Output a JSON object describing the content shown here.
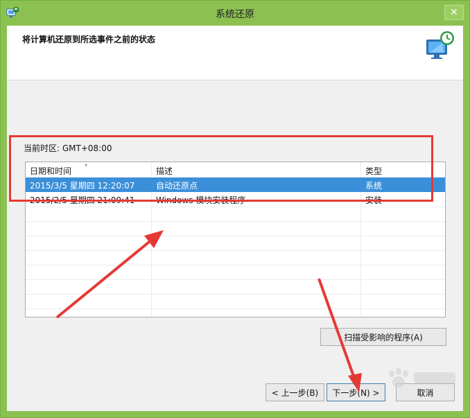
{
  "window": {
    "title": "系统还原",
    "close_glyph": "✕"
  },
  "header": {
    "text": "将计算机还原到所选事件之前的状态"
  },
  "timezone": {
    "label": "当前时区: GMT+08:00"
  },
  "table": {
    "columns": [
      "日期和时间",
      "描述",
      "类型"
    ],
    "rows": [
      {
        "datetime": "2015/3/5 星期四 12:20:07",
        "description": "自动还原点",
        "type": "系统",
        "selected": true
      },
      {
        "datetime": "2015/2/5 星期四 21:09:41",
        "description": "Windows 模块安装程序",
        "type": "安装",
        "selected": false
      }
    ]
  },
  "buttons": {
    "scan": "扫描受影响的程序(A)",
    "back": "< 上一步(B)",
    "next": "下一步(N) >",
    "cancel": "取消"
  },
  "annotations": {
    "highlight_color": "#e53935"
  },
  "icons": {
    "app": "system-restore-app-icon",
    "hero": "system-restore-monitor-icon",
    "close": "close-icon",
    "sort": "sort-arrow-icon"
  }
}
